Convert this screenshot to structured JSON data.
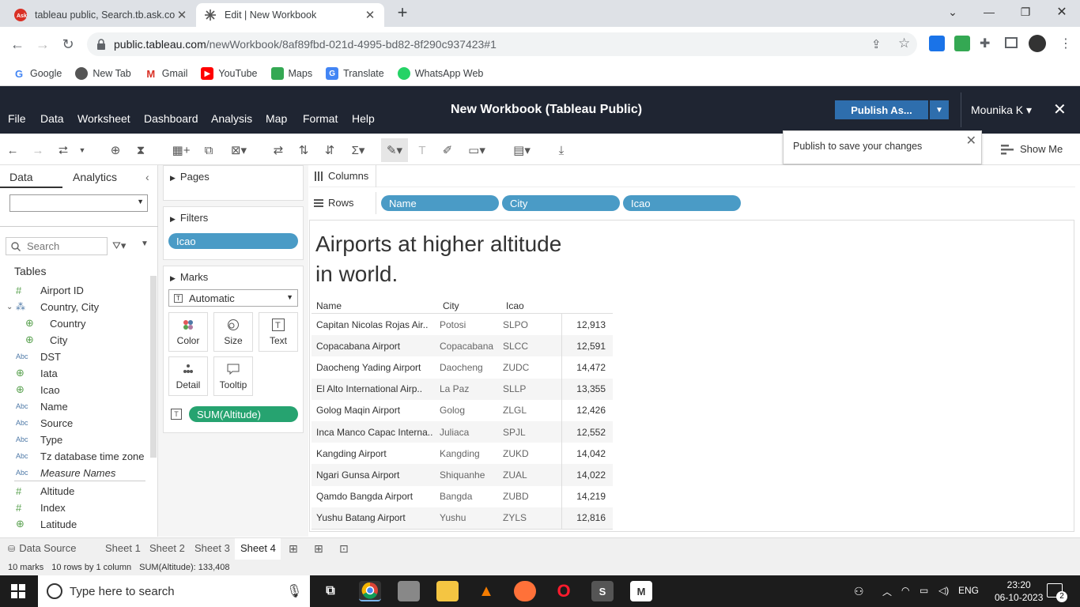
{
  "browser": {
    "tabs": [
      {
        "title": "tableau public, Search.tb.ask.com",
        "active": false
      },
      {
        "title": "Edit | New Workbook",
        "active": true
      }
    ],
    "url_host": "public.tableau.com",
    "url_path": "/newWorkbook/8af89fbd-021d-4995-bd82-8f290c937423#1",
    "bookmarks": [
      "Google",
      "New Tab",
      "Gmail",
      "YouTube",
      "Maps",
      "Translate",
      "WhatsApp Web"
    ]
  },
  "app": {
    "menu": [
      "File",
      "Data",
      "Worksheet",
      "Dashboard",
      "Analysis",
      "Map",
      "Format",
      "Help"
    ],
    "title": "New Workbook (Tableau Public)",
    "publish_label": "Publish As...",
    "user": "Mounika K",
    "user_caret": "▾",
    "publish_tooltip": "Publish to save your changes",
    "show_me": "Show Me"
  },
  "data_pane": {
    "tab_data": "Data",
    "tab_analytics": "Analytics",
    "search_placeholder": "Search",
    "tables_heading": "Tables",
    "fields": [
      {
        "type": "#",
        "label": "Airport ID"
      },
      {
        "type": "hier",
        "label": "Country, City"
      },
      {
        "type": "geo",
        "label": "Country"
      },
      {
        "type": "geo",
        "label": "City"
      },
      {
        "type": "Abc",
        "label": "DST"
      },
      {
        "type": "geo",
        "label": "Iata"
      },
      {
        "type": "geo",
        "label": "Icao"
      },
      {
        "type": "Abc",
        "label": "Name"
      },
      {
        "type": "Abc",
        "label": "Source"
      },
      {
        "type": "Abc",
        "label": "Type"
      },
      {
        "type": "Abc",
        "label": "Tz database time zone"
      },
      {
        "type": "Abc",
        "label": "Measure Names"
      },
      {
        "type": "#",
        "label": "Altitude"
      },
      {
        "type": "#",
        "label": "Index"
      },
      {
        "type": "geo",
        "label": "Latitude"
      }
    ]
  },
  "shelves": {
    "pages_title": "Pages",
    "filters_title": "Filters",
    "filter_pill": "Icao",
    "marks_title": "Marks",
    "mark_type": "Automatic",
    "mark_buttons": [
      "Color",
      "Size",
      "Text",
      "Detail",
      "Tooltip"
    ],
    "marks_pill": "SUM(Altitude)",
    "columns_label": "Columns",
    "rows_label": "Rows",
    "row_pills": [
      "Name",
      "City",
      "Icao"
    ]
  },
  "viz": {
    "title_line1": "Airports at higher altitude",
    "title_line2": "in world.",
    "headers": [
      "Name",
      "City",
      "Icao"
    ],
    "rows": [
      {
        "name": "Capitan Nicolas Rojas Air..",
        "city": "Potosi",
        "icao": "SLPO",
        "value": "12,913"
      },
      {
        "name": "Copacabana Airport",
        "city": "Copacabana",
        "icao": "SLCC",
        "value": "12,591"
      },
      {
        "name": "Daocheng Yading Airport",
        "city": "Daocheng",
        "icao": "ZUDC",
        "value": "14,472"
      },
      {
        "name": "El Alto International Airp..",
        "city": "La Paz",
        "icao": "SLLP",
        "value": "13,355"
      },
      {
        "name": "Golog Maqin Airport",
        "city": "Golog",
        "icao": "ZLGL",
        "value": "12,426"
      },
      {
        "name": "Inca Manco Capac Interna..",
        "city": "Juliaca",
        "icao": "SPJL",
        "value": "12,552"
      },
      {
        "name": "Kangding Airport",
        "city": "Kangding",
        "icao": "ZUKD",
        "value": "14,042"
      },
      {
        "name": "Ngari Gunsa Airport",
        "city": "Shiquanhe",
        "icao": "ZUAL",
        "value": "14,022"
      },
      {
        "name": "Qamdo Bangda Airport",
        "city": "Bangda",
        "icao": "ZUBD",
        "value": "14,219"
      },
      {
        "name": "Yushu Batang Airport",
        "city": "Yushu",
        "icao": "ZYLS",
        "value": "12,816"
      }
    ]
  },
  "sheet_tabs": [
    "Data Source",
    "Sheet 1",
    "Sheet 2",
    "Sheet 3",
    "Sheet 4"
  ],
  "active_sheet": "Sheet 4",
  "status": {
    "marks": "10 marks",
    "rows": "10 rows by 1 column",
    "sum": "SUM(Altitude): 133,408"
  },
  "taskbar": {
    "search_placeholder": "Type here to search",
    "lang": "ENG",
    "time": "23:20",
    "date": "06-10-2023",
    "notifications": "2"
  },
  "colors": {
    "tableau_header": "#1f2532",
    "publish_blue": "#2e6ead",
    "dimension_pill": "#4a9bc6",
    "measure_pill": "#26a370"
  }
}
